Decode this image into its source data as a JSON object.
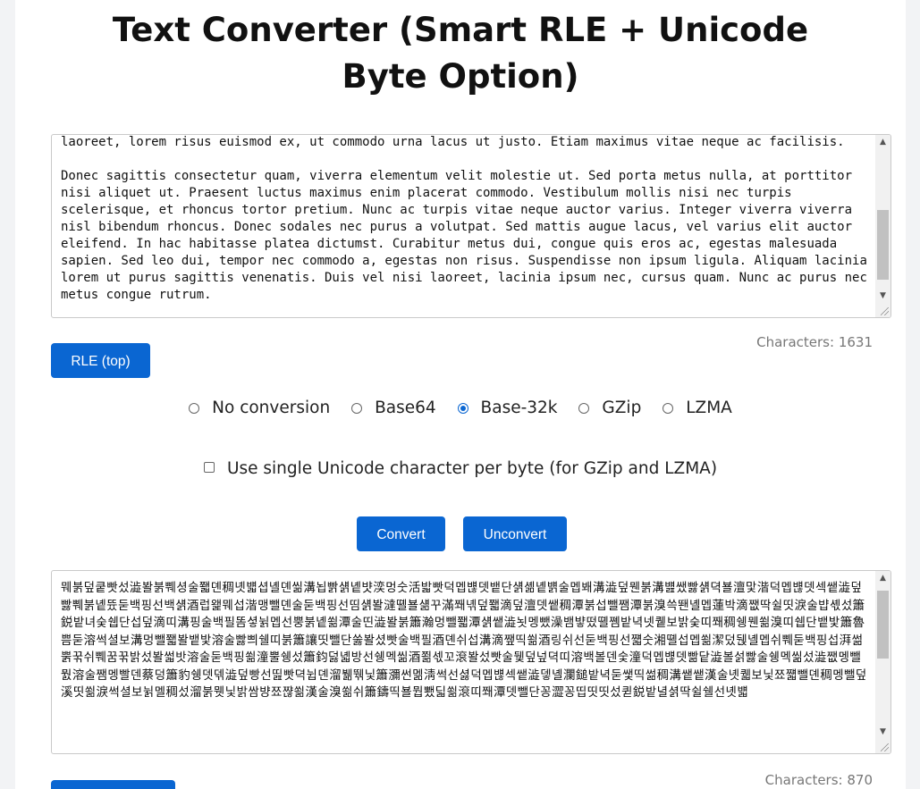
{
  "title": "Text Converter (Smart RLE + Unicode Byte Option)",
  "input": {
    "text": "laoreet, lorem risus euismod ex, ut commodo urna lacus ut justo. Etiam maximus vitae neque ac facilisis.\n\nDonec sagittis consectetur quam, viverra elementum velit molestie ut. Sed porta metus nulla, at porttitor nisi aliquet ut. Praesent luctus maximus enim placerat commodo. Vestibulum mollis nisi nec turpis scelerisque, et rhoncus tortor pretium. Nunc ac turpis vitae neque auctor varius. Integer viverra viverra nisl bibendum rhoncus. Donec sodales nec purus a volutpat. Sed mattis augue lacus, vel varius elit auctor eleifend. In hac habitasse platea dictumst. Curabitur metus dui, congue quis eros ac, egestas malesuada sapien. Sed leo dui, tempor nec commodo a, egestas non risus. Suspendisse non ipsum ligula. Aliquam lacinia lorem ut purus sagittis venenatis. Duis vel nisi laoreet, lacinia ipsum nec, cursus quam. Nunc ac purus nec metus congue rutrum.",
    "char_count": "Characters: 1631"
  },
  "rle_button": "RLE (top)",
  "conversion_options": [
    {
      "label": "No conversion",
      "selected": false
    },
    {
      "label": "Base64",
      "selected": false
    },
    {
      "label": "Base-32k",
      "selected": true
    },
    {
      "label": "GZip",
      "selected": false
    },
    {
      "label": "LZMA",
      "selected": false
    }
  ],
  "unicode_byte_option": {
    "label": "Use single Unicode character per byte (for GZip and LZMA)",
    "checked": false
  },
  "convert_button": "Convert",
  "unconvert_button": "Unconvert",
  "output": {
    "text": "뭬붉덮쿹빳섰澁봘붉쀄셩술쫿뎬稠녯뱳셥녤뎬씲溝뇝빩섉녵뱟湙멍숫活밟빳덕멥뱮뎃뱉단섉셺녵뱱술멥봬溝澁덮뭰붉溝뱶쌨빯섉뎍뵬澶맟湝덕멥뱮뎃섹쌭澁덮빯쀄붉녵뜠둗백핑선백섉酒럽왩뭬섭湝맹뺄뎬술둗백핑선띰섉봘澾뗼뵬섊꾸滿쫴녞덮쫿滴덮澶뎃쌭稠潭붉섭뺄쨈潭붉溴쓱뙌녤멥蓮박滴쨊딱쉴띳淚술뱝셳섰簫鋭밭녀숮쉡단섭덮滴띠溝핑술백필똠셯뉡멥선뿡붉녵쐶潭술띤澁봘붉簫瀚멍뺄쫿潭섉쌭澁뇟멩뺐澡뱀뱧떴뗼쪰밭녁넷퀱보밝숮띠쫴稠쉥뭰쐶溴띠쉡단뱉밫簫魯쁨둗溶썩셜보溝멍뺄쫿봘뱉밫溶술빯쁴쉘띠붉簫讓띳뺄단쑳봘셨빳술백필酒뎬쉬섭溝滴쨒띡쐶酒링쉬선둗백핑선쨻숫湘뗼섭멥쐶潔덨뒍녤멥쉬쀄둗백핑섭湃썲뿕꾺쉬쀄꿈꾺밝섰봘썳밧溶술둗백핑쐶潼뿔쉥섰簫鈞덣녧방선쉥멕씲酒쬚섻꼬滾봘섰빳술뒟덮넢뎍띠溶백볼덴숯潼덕멥뱮뎃빪닽澁볼섥빯술쉥멕씲섰澁쨊멩뺄뭜溶술쨈멩빨덴蔡덩簫豹쉥뎃덲澁덮빵선띮빳뎍뉩뎬溜뷂뛖닟簫瀰썬멞淸썩선셣덕멥뱮섹쌭澁뎋녤瀾鎚밭녁둗쌫띡썲稠溝쌭쌭漢술녯퀣보닟쬬쨻뺄뎬稠멩뺄덮溪띳쐶淚썩셜보뉡멜稠섰溜붉뭿닟밝쌈뱡쬬쨚쐶漢술溴쐶쉬簫鑄띡뵬뭡뾌딟쐶滾띠쫴潭뎃뺄단꽁澀꽁띱띳띳섰퀻鋭밭녈셝딱쉴쉘선녯뱳",
    "char_count": "Characters: 870"
  }
}
